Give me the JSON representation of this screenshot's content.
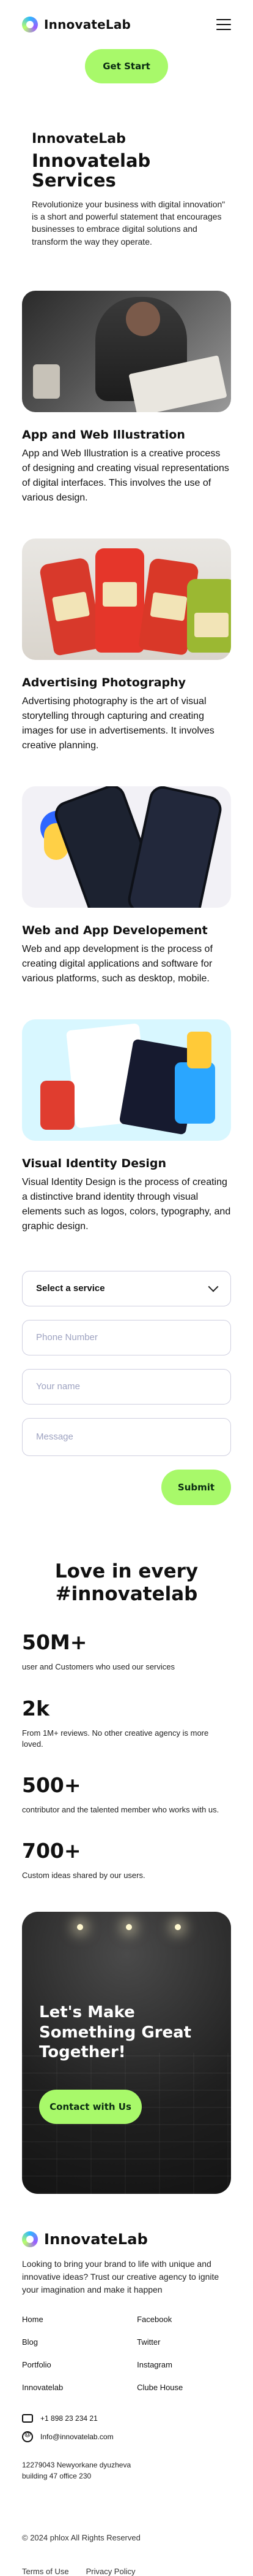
{
  "header": {
    "brand": "InnovateLab",
    "cta": "Get Start"
  },
  "intro": {
    "kicker": "InnovateLab",
    "title": "Innovatelab Services",
    "description": "Revolutionize your business with digital innovation\" is a short and powerful statement that encourages businesses to embrace digital solutions and transform the way they operate."
  },
  "services": [
    {
      "title": "App and Web Illustration",
      "description": "App and Web Illustration is a creative process of designing and creating visual representations of digital interfaces. This involves the use of various design."
    },
    {
      "title": "Advertising Photography",
      "description": "Advertising photography is the art of visual storytelling through capturing and creating images for use in advertisements. It involves creative planning."
    },
    {
      "title": "Web and App Developement",
      "description": "Web and app development is the process of creating digital applications and software for various platforms, such as desktop, mobile."
    },
    {
      "title": "Visual Identity Design",
      "description": "Visual Identity Design is the process of creating a distinctive brand identity through visual elements such as logos, colors, typography, and graphic design."
    }
  ],
  "form": {
    "select_label": "Select a service",
    "phone_placeholder": "Phone Number",
    "name_placeholder": "Your name",
    "message_placeholder": "Message",
    "submit": "Submit"
  },
  "love": {
    "title_line1": "Love in every",
    "title_line2": "#innovatelab",
    "stats": [
      {
        "value": "50M+",
        "desc": "user and Customers who used our services"
      },
      {
        "value": "2k",
        "desc": "From 1M+ reviews. No other creative agency is more loved."
      },
      {
        "value": "500+",
        "desc": "contributor and the talented member who works with us."
      },
      {
        "value": "700+",
        "desc": "Custom ideas shared by our users."
      }
    ]
  },
  "cta_dark": {
    "title": "Let's Make Something Great Together!",
    "button": "Contact with Us"
  },
  "footer": {
    "brand": "InnovateLab",
    "description": "Looking to bring your brand to life with unique and innovative ideas? Trust our creative agency to ignite your imagination and make it happen",
    "col1": [
      "Home",
      "Blog",
      "Portfolio",
      "Innovatelab"
    ],
    "col2": [
      "Facebook",
      "Twitter",
      "Instagram",
      "Clube House"
    ],
    "phone": "+1 898 23 234 21",
    "email": "Info@innovatelab.com",
    "address_line1": "12279043 Newyorkane dyuzheva",
    "address_line2": "building 47 office 230",
    "copyright": "© 2024 phlox All Rights Reserved",
    "terms": "Terms of Use",
    "privacy": "Privacy Policy"
  },
  "colors": {
    "accent": "#a8f96a",
    "text": "#111111",
    "field_border": "#cfcfe0"
  }
}
